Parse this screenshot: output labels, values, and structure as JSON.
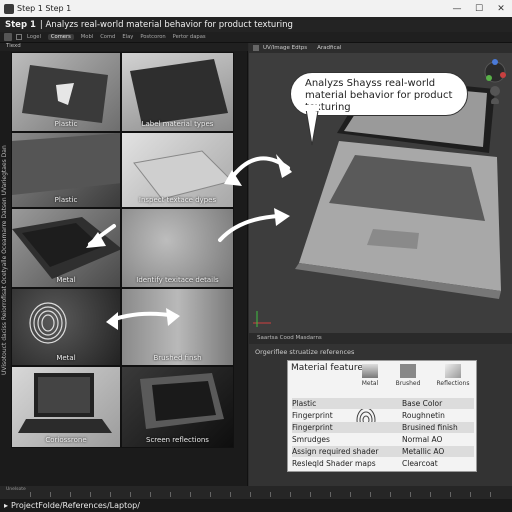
{
  "window": {
    "title": "Step 1 Step 1",
    "minimize": "—",
    "maximize": "☐",
    "close": "✕"
  },
  "step": {
    "label": "Step 1",
    "text": "| Analyzs real-world material behavior for product texturing"
  },
  "toolbar": {
    "items": [
      "Logel",
      "Comers",
      "Mobl",
      "Comd",
      "Elay",
      "Postcoron",
      "Pertor dapas"
    ],
    "active": "Comers"
  },
  "left_panel": {
    "header": "Tiexd",
    "vertical_text": "UVisotouct daciss Reiorrofisat Ocetyalle Oceamarre Datsen UVariegtaes Dan",
    "tiles": [
      {
        "caption": "Plastic"
      },
      {
        "caption": "Label material types"
      },
      {
        "caption": "Plastic"
      },
      {
        "caption": "Inspect textace dypes"
      },
      {
        "caption": "Metal"
      },
      {
        "caption": "Identify texitace details"
      },
      {
        "caption": "Metal"
      },
      {
        "caption": "Brushed finsh"
      },
      {
        "caption": "Coriossrone"
      },
      {
        "caption": "Screen reflections"
      }
    ]
  },
  "viewport": {
    "tabs": [
      "UV/Image Edtps",
      "Aradfical"
    ],
    "bubble": "Analyzs Shayss real-world material behavior for product texturing"
  },
  "materials_panel": {
    "header": "Saartsa Cood Masdarns",
    "subheader": "Orgeriflee struatize references",
    "card_title": "Material features",
    "chips": [
      "Metal",
      "Brushed",
      "Reflections"
    ],
    "rows": [
      {
        "left": "Plastic",
        "right": "Base Color"
      },
      {
        "left": "Fingerprint",
        "right": "Roughnetin"
      },
      {
        "left": "Fingerprint",
        "right": "Brusined finish"
      },
      {
        "left": "Smrudges",
        "right": "Normal AO"
      },
      {
        "left": "Assign required shader",
        "right": "Metallic AO"
      },
      {
        "left": "Resleqld Shader maps",
        "right": "Clearcoat"
      }
    ]
  },
  "timeline": {
    "label": "Unelsote"
  },
  "path": {
    "text": "ProjectFolde/References/Laptop/"
  }
}
